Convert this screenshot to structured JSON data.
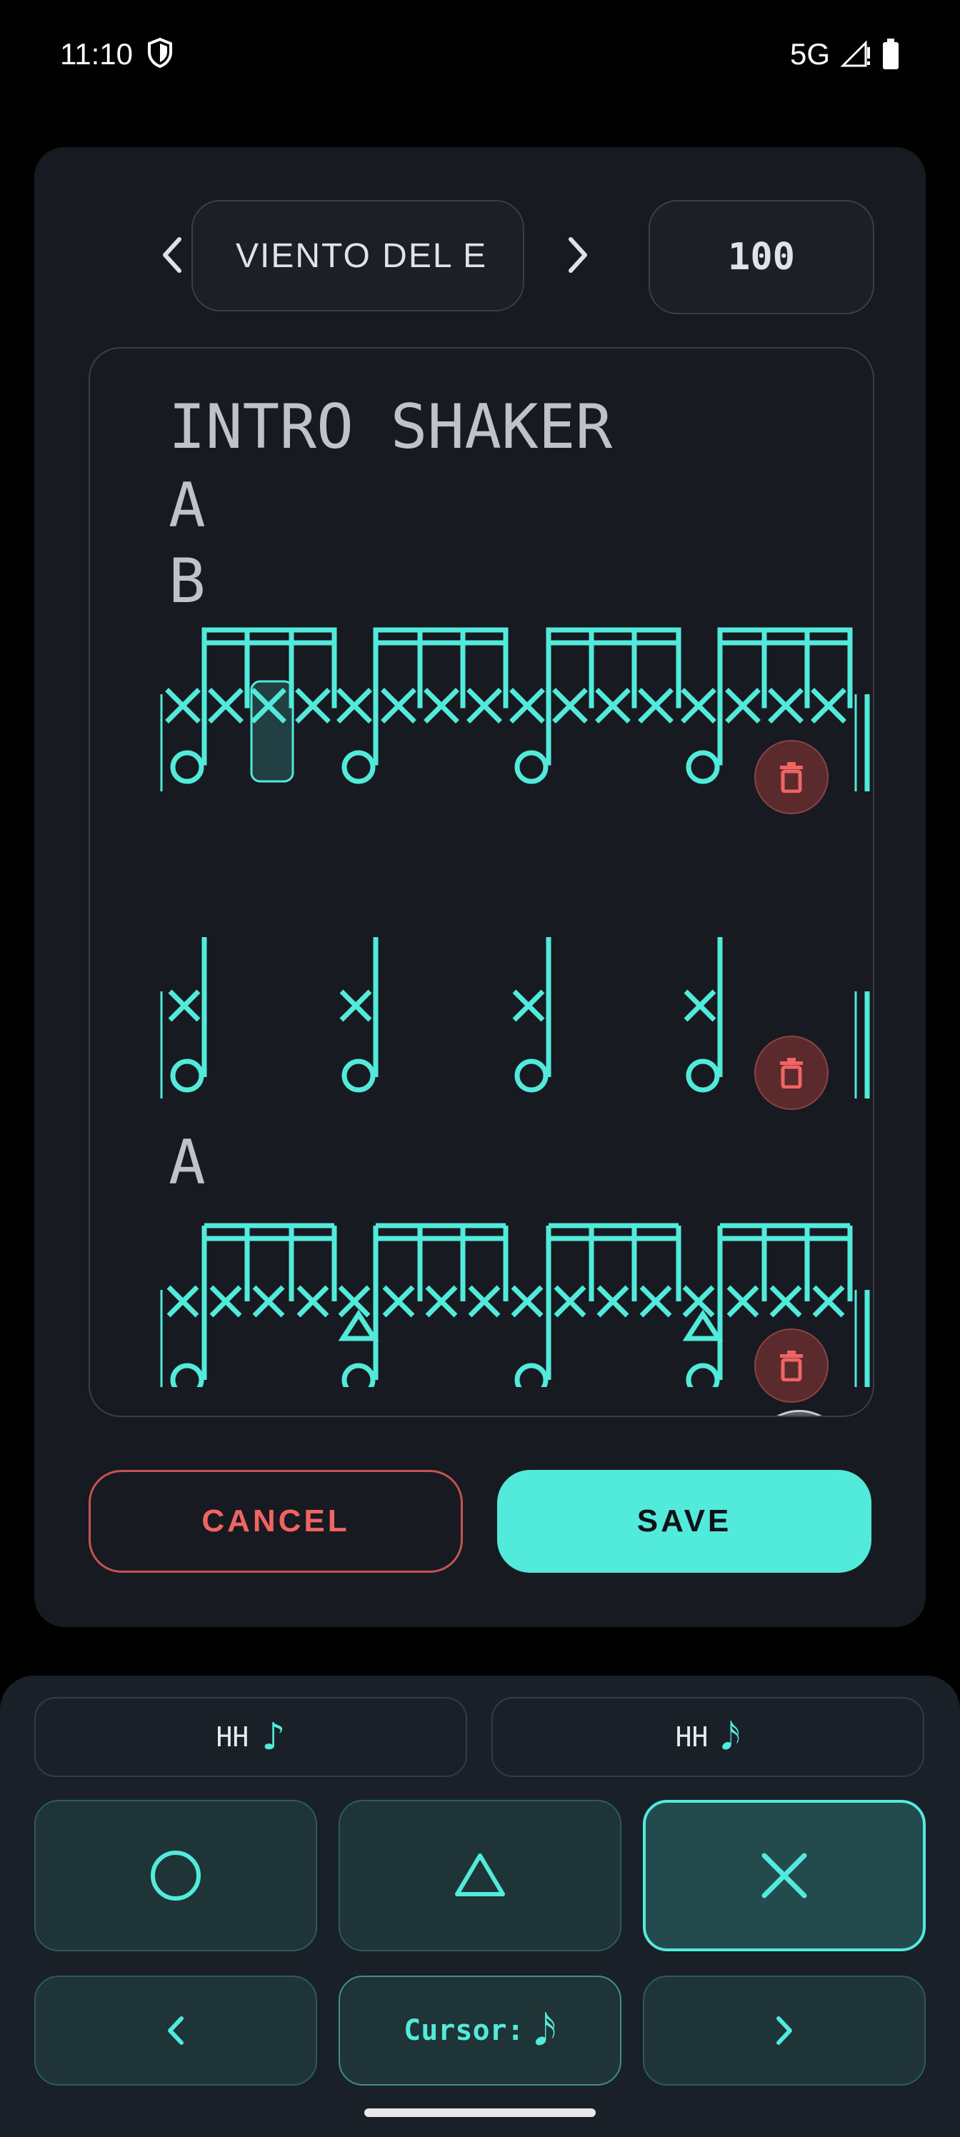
{
  "status": {
    "time": "11:10",
    "network": "5G"
  },
  "song": {
    "title": "VIENTO DEL E",
    "bpm": "100"
  },
  "editor": {
    "sections": [
      "INTRO SHAKER",
      "A",
      "B",
      "A"
    ]
  },
  "actions": {
    "cancel_label": "CANCEL",
    "save_label": "SAVE"
  },
  "palette": {
    "voices": [
      {
        "label": "HH",
        "note": "♪"
      },
      {
        "label": "HH",
        "note": "𝅘𝅥𝅯"
      }
    ],
    "cursor_label": "Cursor:",
    "cursor_note": "𝅘𝅥𝅯"
  },
  "colors": {
    "accent": "#52eadb",
    "danger": "#f06464",
    "panel": "#171b21"
  }
}
